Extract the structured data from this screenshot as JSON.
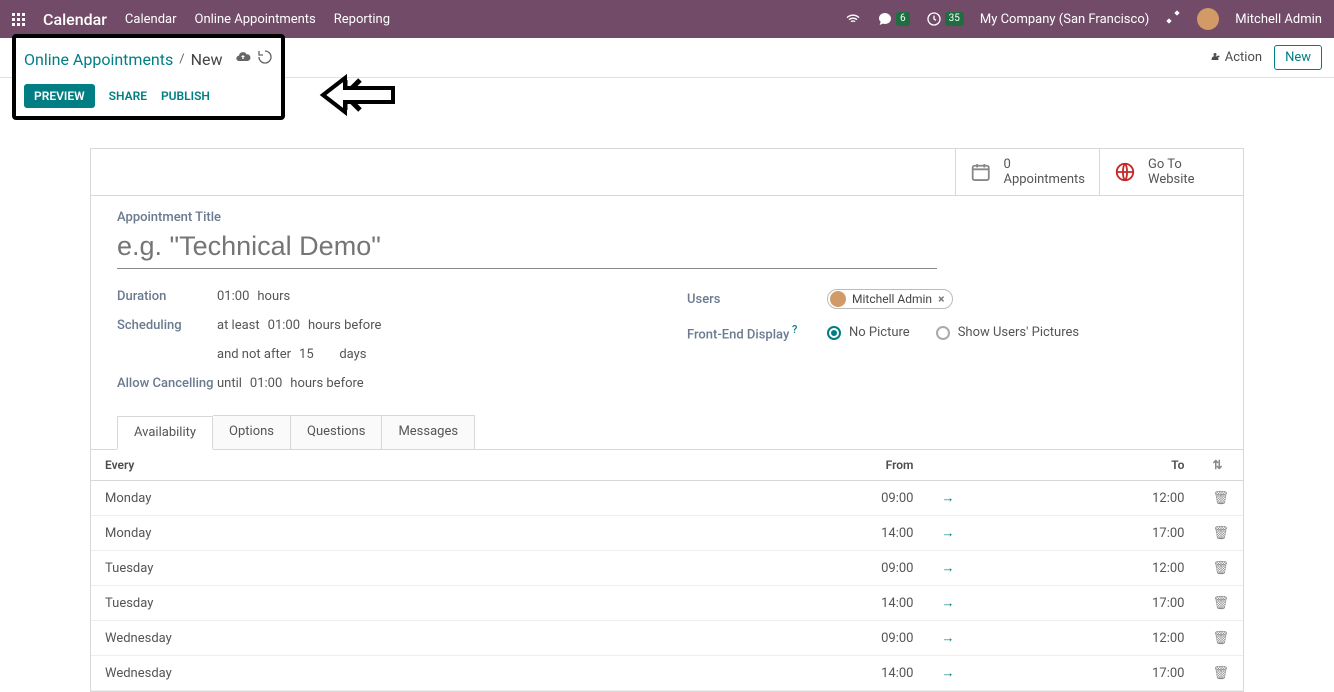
{
  "topbar": {
    "app_name": "Calendar",
    "nav": [
      "Calendar",
      "Online Appointments",
      "Reporting"
    ],
    "chat_badge": "6",
    "clock_badge": "35",
    "company": "My Company (San Francisco)",
    "user": "Mitchell Admin"
  },
  "breadcrumb": {
    "parent": "Online Appointments",
    "current": "New"
  },
  "actions": {
    "action_label": "Action",
    "new_label": "New"
  },
  "toolbar": {
    "preview": "PREVIEW",
    "share": "SHARE",
    "publish": "PUBLISH"
  },
  "stats": {
    "appointments_count": "0",
    "appointments_label": "Appointments",
    "goto_label1": "Go To",
    "goto_label2": "Website"
  },
  "form": {
    "title_label": "Appointment Title",
    "title_placeholder": "e.g. \"Technical Demo\"",
    "duration_label": "Duration",
    "duration_value": "01:00",
    "duration_unit": "hours",
    "scheduling_label": "Scheduling",
    "sched_atleast": "at least",
    "sched_atleast_val": "01:00",
    "sched_atleast_unit": "hours before",
    "sched_notafter": "and not after",
    "sched_notafter_val": "15",
    "sched_notafter_unit": "days",
    "allow_cancel_label": "Allow Cancelling",
    "cancel_until": "until",
    "cancel_val": "01:00",
    "cancel_unit": "hours before",
    "users_label": "Users",
    "user_tag": "Mitchell Admin",
    "fed_label": "Front-End Display",
    "fed_opt1": "No Picture",
    "fed_opt2": "Show Users' Pictures"
  },
  "tabs": [
    "Availability",
    "Options",
    "Questions",
    "Messages"
  ],
  "availability": {
    "col_every": "Every",
    "col_from": "From",
    "col_to": "To",
    "rows": [
      {
        "day": "Monday",
        "from": "09:00",
        "to": "12:00"
      },
      {
        "day": "Monday",
        "from": "14:00",
        "to": "17:00"
      },
      {
        "day": "Tuesday",
        "from": "09:00",
        "to": "12:00"
      },
      {
        "day": "Tuesday",
        "from": "14:00",
        "to": "17:00"
      },
      {
        "day": "Wednesday",
        "from": "09:00",
        "to": "12:00"
      },
      {
        "day": "Wednesday",
        "from": "14:00",
        "to": "17:00"
      }
    ]
  }
}
